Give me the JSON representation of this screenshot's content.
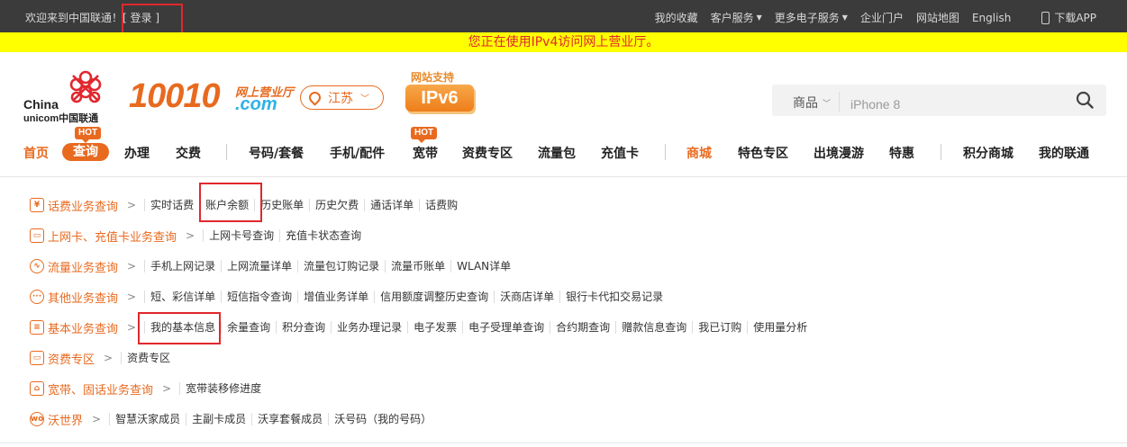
{
  "topbar": {
    "welcome": "欢迎来到中国联通！",
    "login_prefix": "[ ",
    "login": "登录",
    "login_suffix": " ]",
    "links": [
      "我的收藏",
      "客户服务",
      "更多电子服务",
      "企业门户",
      "网站地图",
      "English"
    ],
    "dropdown_marks": [
      "▼",
      "▼"
    ],
    "download": "下载APP"
  },
  "notice": "您正在使用IPv4访问网上营业厅。",
  "logo": {
    "line1": "China",
    "line2": "unicom中国联通"
  },
  "brand": {
    "number": "10010",
    "sub1": "网上营业厅",
    "sub2": ".com"
  },
  "region": {
    "name": "江苏"
  },
  "ipv6": {
    "label": "网站支持",
    "badge": "IPv6"
  },
  "search": {
    "category": "商品",
    "placeholder": "iPhone 8"
  },
  "nav": {
    "items": [
      "首页",
      "查询",
      "办理",
      "交费",
      "号码/套餐",
      "手机/配件",
      "宽带",
      "资费专区",
      "流量包",
      "充值卡",
      "商城",
      "特色专区",
      "出境漫游",
      "特惠",
      "积分商城",
      "我的联通"
    ],
    "hot": "HOT"
  },
  "categories": [
    {
      "icon": "¥",
      "title": "话费业务查询",
      "links": [
        "实时话费",
        "账户余额",
        "历史账单",
        "历史欠费",
        "通话详单",
        "话费购"
      ]
    },
    {
      "icon": "▭",
      "title": "上网卡、充值卡业务查询",
      "links": [
        "上网卡号查询",
        "充值卡状态查询"
      ]
    },
    {
      "icon": "∿",
      "title": "流量业务查询",
      "links": [
        "手机上网记录",
        "上网流量详单",
        "流量包订购记录",
        "流量币账单",
        "WLAN详单"
      ]
    },
    {
      "icon": "···",
      "title": "其他业务查询",
      "links": [
        "短、彩信详单",
        "短信指令查询",
        "增值业务详单",
        "信用额度调整历史查询",
        "沃商店详单",
        "银行卡代扣交易记录"
      ]
    },
    {
      "icon": "≡",
      "title": "基本业务查询",
      "links": [
        "我的基本信息",
        "余量查询",
        "积分查询",
        "业务办理记录",
        "电子发票",
        "电子受理单查询",
        "合约期查询",
        "赠款信息查询",
        "我已订购",
        "使用量分析"
      ]
    },
    {
      "icon": "▭",
      "title": "资费专区",
      "links": [
        "资费专区"
      ]
    },
    {
      "icon": "⌂",
      "title": "宽带、固话业务查询",
      "links": [
        "宽带装移修进度"
      ]
    },
    {
      "icon": "wo",
      "title": "沃世界",
      "links": [
        "智慧沃家成员",
        "主副卡成员",
        "沃享套餐成员",
        "沃号码（我的号码）"
      ]
    }
  ]
}
